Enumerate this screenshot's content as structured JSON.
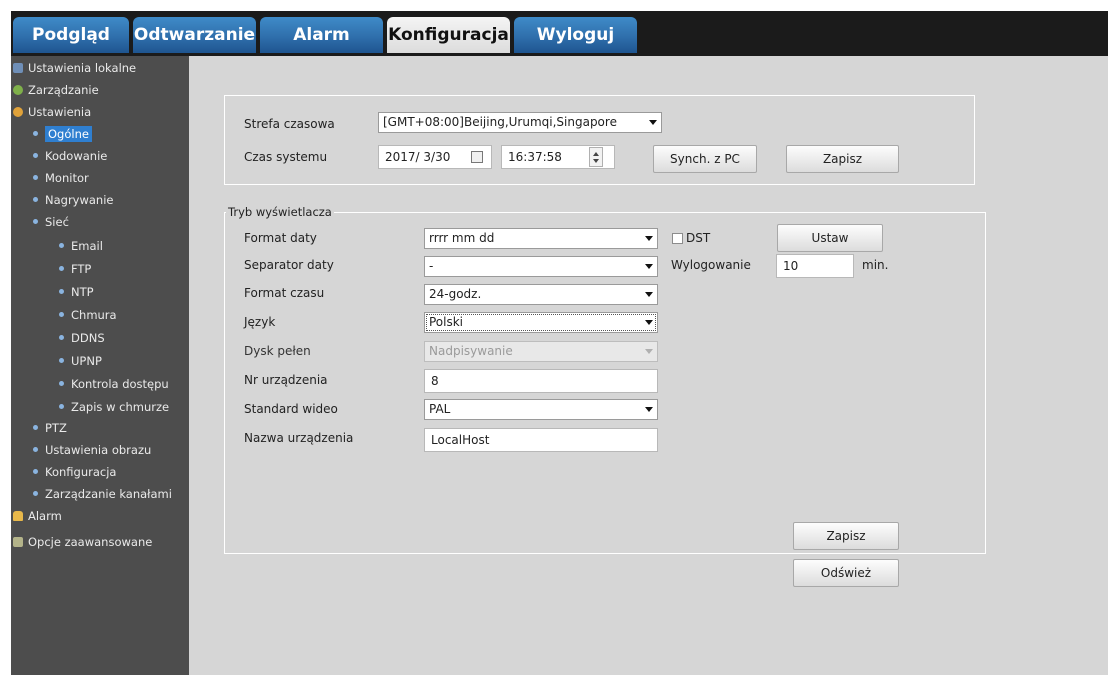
{
  "nav": {
    "tabs": [
      {
        "label": "Podgląd"
      },
      {
        "label": "Odtwarzanie"
      },
      {
        "label": "Alarm"
      },
      {
        "label": "Konfiguracja"
      },
      {
        "label": "Wyloguj"
      }
    ],
    "active_tab": "Konfiguracja"
  },
  "sidebar": {
    "items": [
      {
        "label": "Ustawienia lokalne",
        "icon": "local-settings-icon"
      },
      {
        "label": "Zarządzanie",
        "icon": "management-icon"
      },
      {
        "label": "Ustawienia",
        "icon": "settings-icon"
      },
      {
        "label": "Ogólne",
        "selected": true
      },
      {
        "label": "Kodowanie"
      },
      {
        "label": "Monitor"
      },
      {
        "label": "Nagrywanie"
      },
      {
        "label": "Sieć"
      },
      {
        "label": "Email"
      },
      {
        "label": "FTP"
      },
      {
        "label": "NTP"
      },
      {
        "label": "Chmura"
      },
      {
        "label": "DDNS"
      },
      {
        "label": "UPNP"
      },
      {
        "label": "Kontrola dostępu"
      },
      {
        "label": "Zapis w chmurze"
      },
      {
        "label": "PTZ"
      },
      {
        "label": "Ustawienia obrazu"
      },
      {
        "label": "Konfiguracja"
      },
      {
        "label": "Zarządzanie kanałami"
      },
      {
        "label": "Alarm",
        "icon": "alarm-bell-icon"
      },
      {
        "label": "Opcje zaawansowane",
        "icon": "advanced-tools-icon"
      }
    ]
  },
  "time_panel": {
    "timezone_label": "Strefa czasowa",
    "timezone_value": "[GMT+08:00]Beijing,Urumqi,Singapore",
    "system_time_label": "Czas systemu",
    "date_value": "2017/ 3/30",
    "time_value": "16:37:58",
    "sync_button": "Synch. z PC",
    "save_button": "Zapisz"
  },
  "display_panel": {
    "legend": "Tryb wyświetlacza",
    "date_format_label": "Format daty",
    "date_format_value": "rrrr mm dd",
    "dst_label": "DST",
    "dst_checked": false,
    "set_button": "Ustaw",
    "date_separator_label": "Separator daty",
    "date_separator_value": "-",
    "logout_label": "Wylogowanie",
    "logout_value": "10",
    "logout_unit": "min.",
    "time_format_label": "Format czasu",
    "time_format_value": "24-godz.",
    "language_label": "Język",
    "language_value": "Polski",
    "disk_full_label": "Dysk pełen",
    "disk_full_value": "Nadpisywanie",
    "device_no_label": "Nr urządzenia",
    "device_no_value": "8",
    "video_standard_label": "Standard wideo",
    "video_standard_value": "PAL",
    "device_name_label": "Nazwa urządzenia",
    "device_name_value": "LocalHost",
    "save_button": "Zapisz",
    "refresh_button": "Odśwież"
  },
  "colors": {
    "tab_blue": "#2f6fac",
    "sidebar_bg": "#4d4d4d",
    "main_bg": "#d6d6d6",
    "selected_blue": "#2f7fd0"
  }
}
